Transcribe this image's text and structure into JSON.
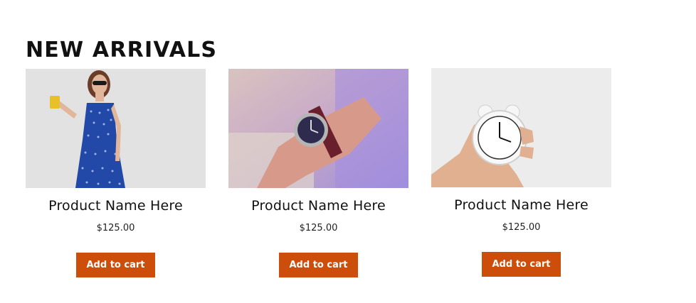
{
  "section": {
    "title": "NEW ARRIVALS"
  },
  "products": [
    {
      "name": "Product Name Here",
      "price": "$125.00",
      "cta": "Add to cart",
      "image": "woman-in-blue-dress-photo"
    },
    {
      "name": "Product Name Here",
      "price": "$125.00",
      "cta": "Add to cart",
      "image": "wristwatch-photo"
    },
    {
      "name": "Product Name Here",
      "price": "$125.00",
      "cta": "Add to cart",
      "image": "alarm-clock-photo"
    }
  ],
  "colors": {
    "button_bg": "#cc4e0a",
    "button_text": "#ffffff",
    "heading": "#111111"
  }
}
